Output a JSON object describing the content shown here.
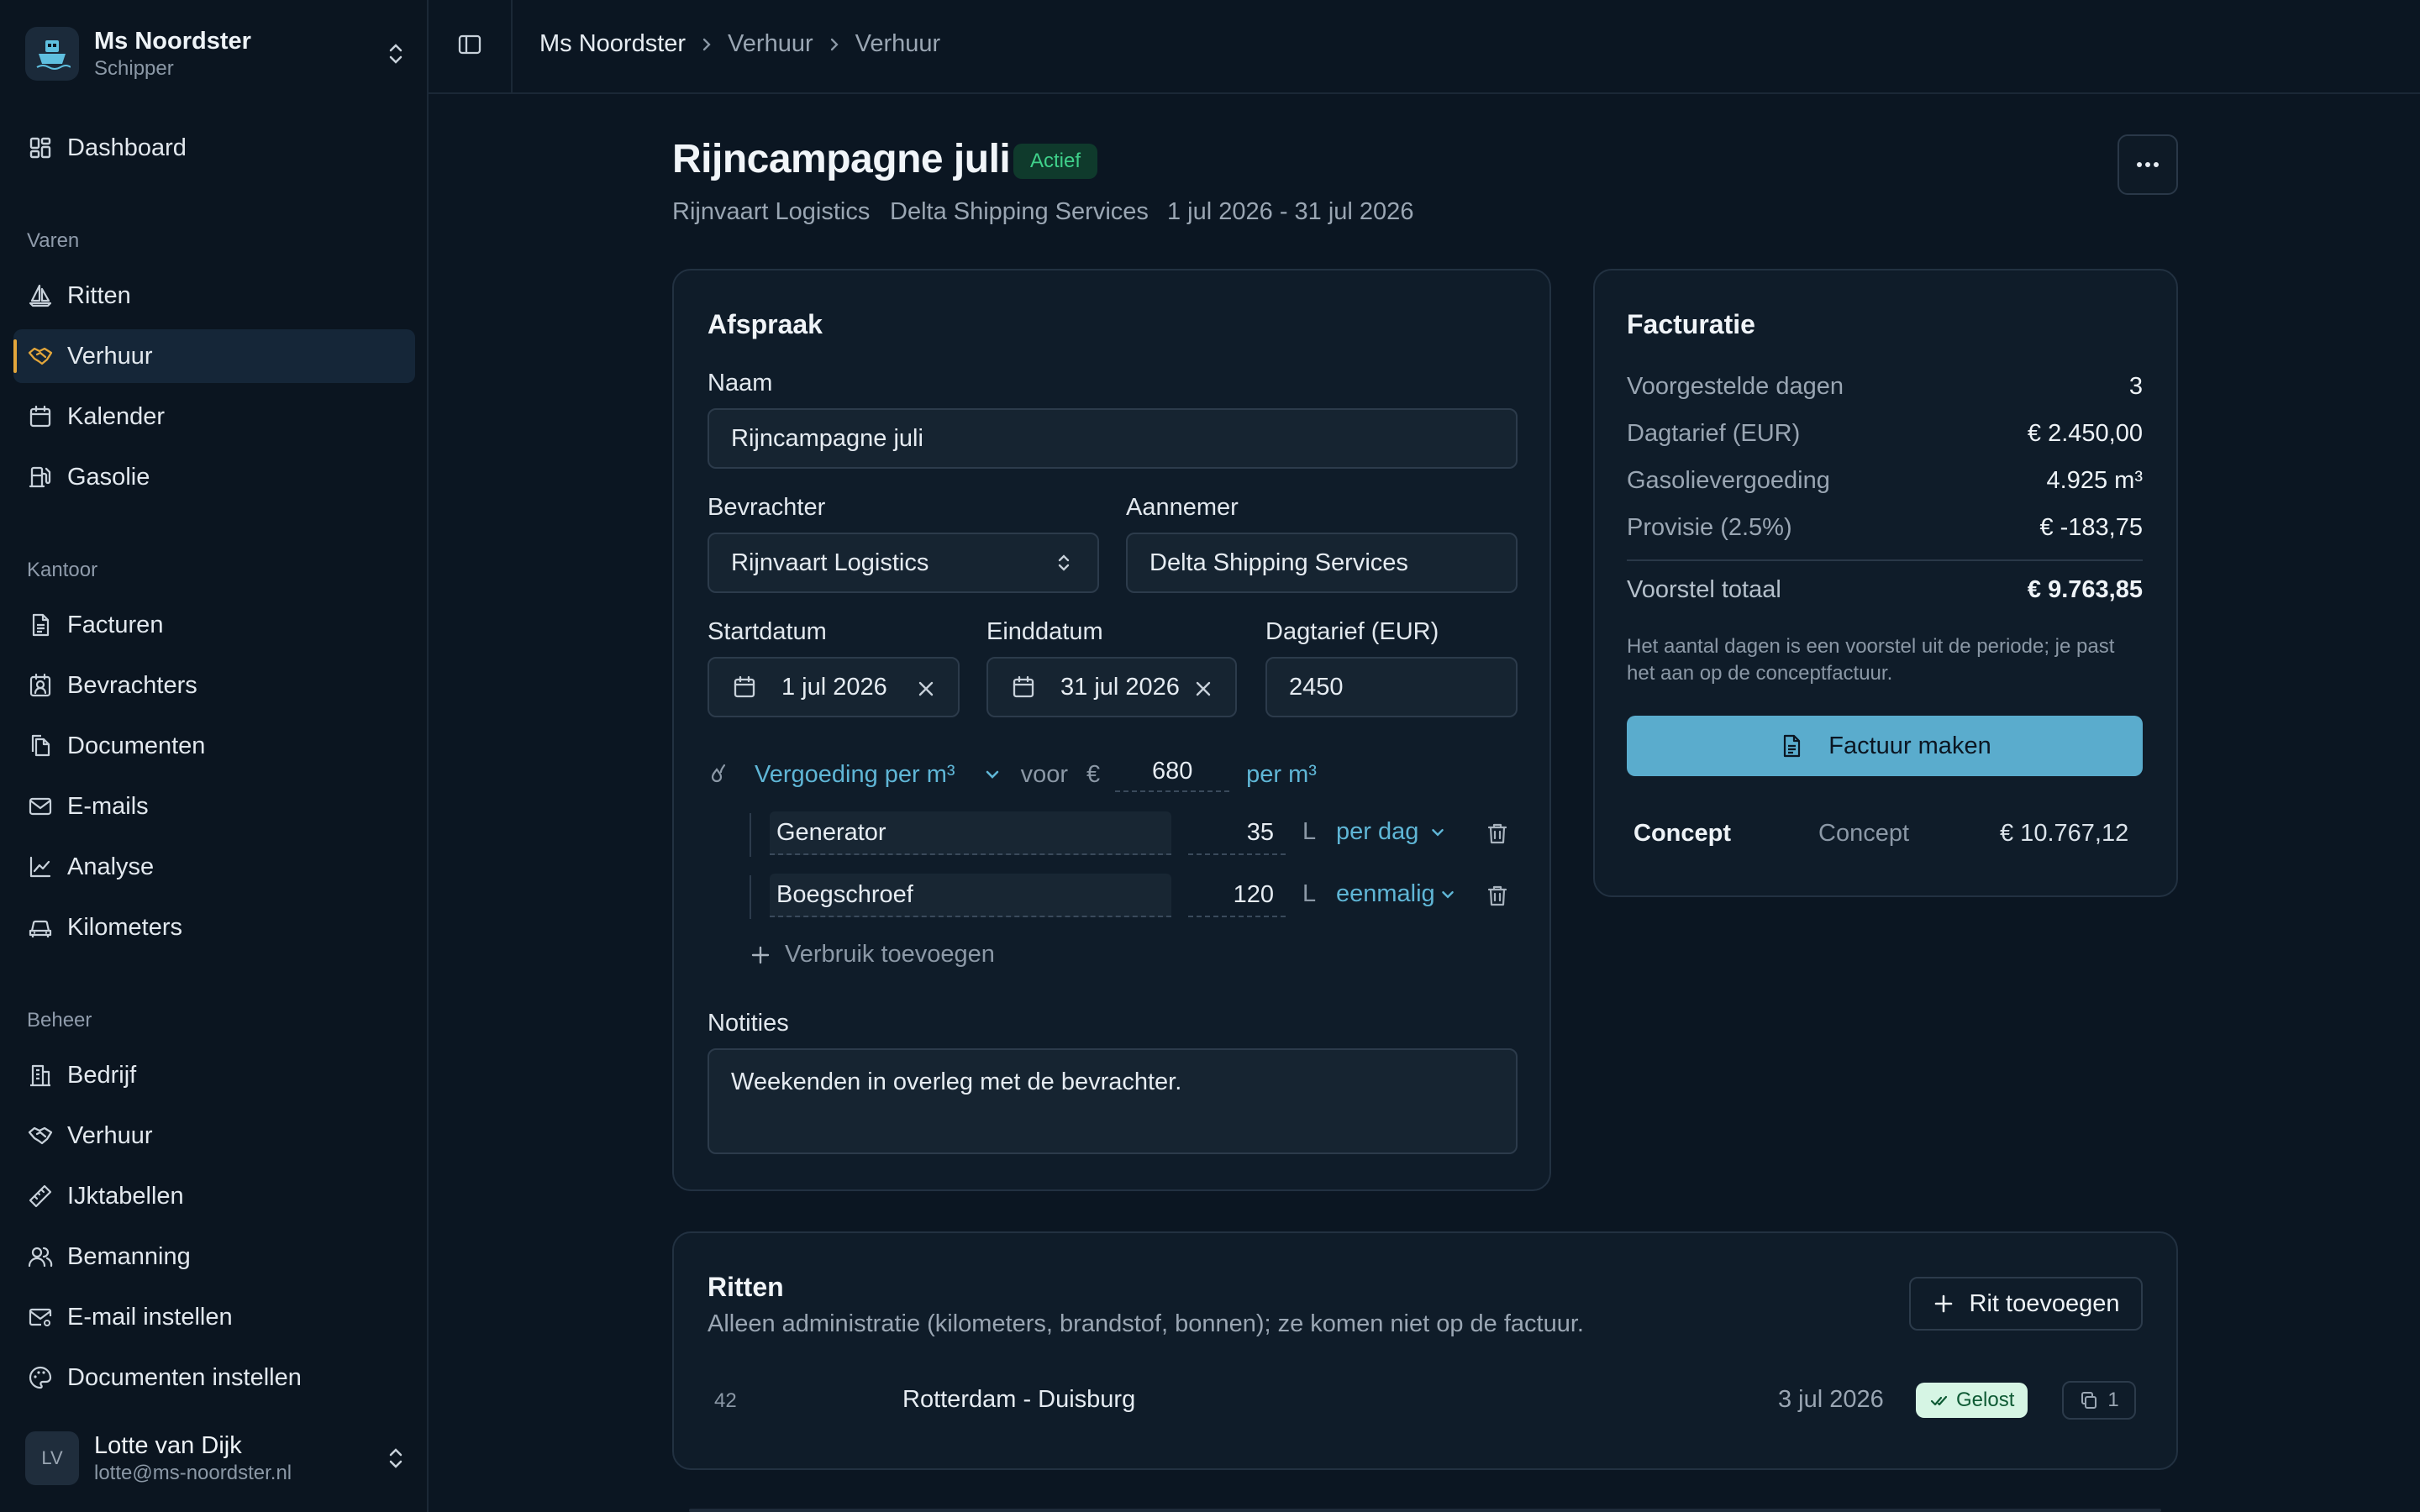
{
  "sidebar": {
    "team": {
      "name": "Ms Noordster",
      "role": "Schipper"
    },
    "dashboard": "Dashboard",
    "sections": {
      "varen": "Varen",
      "kantoor": "Kantoor",
      "beheer": "Beheer"
    },
    "varen_items": [
      "Ritten",
      "Verhuur",
      "Kalender",
      "Gasolie"
    ],
    "kantoor_items": [
      "Facturen",
      "Bevrachters",
      "Documenten",
      "E-mails",
      "Analyse",
      "Kilometers"
    ],
    "beheer_items": [
      "Bedrijf",
      "Verhuur",
      "IJktabellen",
      "Bemanning",
      "E-mail instellen",
      "Documenten instellen"
    ],
    "user": {
      "initials": "LV",
      "name": "Lotte van Dijk",
      "email": "lotte@ms-noordster.nl"
    },
    "accent": "#e3a63b"
  },
  "breadcrumb": [
    "Ms Noordster",
    "Verhuur",
    "Verhuur"
  ],
  "header": {
    "title": "Rijncampagne juli",
    "status": "Actief",
    "subtitle": [
      "Rijnvaart Logistics",
      "Delta Shipping Services",
      "1 jul 2026 - 31 jul 2026"
    ]
  },
  "afspraak": {
    "title": "Afspraak",
    "naam_label": "Naam",
    "naam_value": "Rijncampagne juli",
    "bevrachter_label": "Bevrachter",
    "bevrachter_value": "Rijnvaart Logistics",
    "aannemer_label": "Aannemer",
    "aannemer_value": "Delta Shipping Services",
    "startdatum_label": "Startdatum",
    "startdatum_value": "1 jul 2026",
    "einddatum_label": "Einddatum",
    "einddatum_value": "31 jul 2026",
    "dagtarief_label": "Dagtarief (EUR)",
    "dagtarief_value": "2450",
    "vergoeding": {
      "mode": "Vergoeding per m³",
      "voor": "voor",
      "currency": "€",
      "amount": "680",
      "unit": "per m³"
    },
    "verbruik": [
      {
        "name": "Generator",
        "qty": "35",
        "unit": "L",
        "freq": "per dag"
      },
      {
        "name": "Boegschroef",
        "qty": "120",
        "unit": "L",
        "freq": "eenmalig"
      }
    ],
    "add_verbruik": "Verbruik toevoegen",
    "notities_label": "Notities",
    "notities_value": "Weekenden in overleg met de bevrachter."
  },
  "facturatie": {
    "title": "Facturatie",
    "rows": [
      {
        "k": "Voorgestelde dagen",
        "v": "3"
      },
      {
        "k": "Dagtarief (EUR)",
        "v": "€ 2.450,00"
      },
      {
        "k": "Gasolievergoeding",
        "v": "4.925 m³"
      },
      {
        "k": "Provisie (2.5%)",
        "v": "€ -183,75"
      }
    ],
    "total": {
      "k": "Voorstel totaal",
      "v": "€ 9.763,85"
    },
    "note": "Het aantal dagen is een voorstel uit de periode; je past het aan op de conceptfactuur.",
    "button": "Factuur maken",
    "concept": {
      "name": "Concept",
      "status": "Concept",
      "amount": "€ 10.767,12"
    },
    "button_color": "#5aaccd"
  },
  "ritten": {
    "title": "Ritten",
    "description": "Alleen administratie (kilometers, brandstof, bonnen); ze komen niet op de factuur.",
    "add_button": "Rit toevoegen",
    "rows": [
      {
        "nr": "42",
        "route": "Rotterdam - Duisburg",
        "date": "3 jul 2026",
        "status": "Gelost",
        "docs": "1"
      }
    ]
  }
}
